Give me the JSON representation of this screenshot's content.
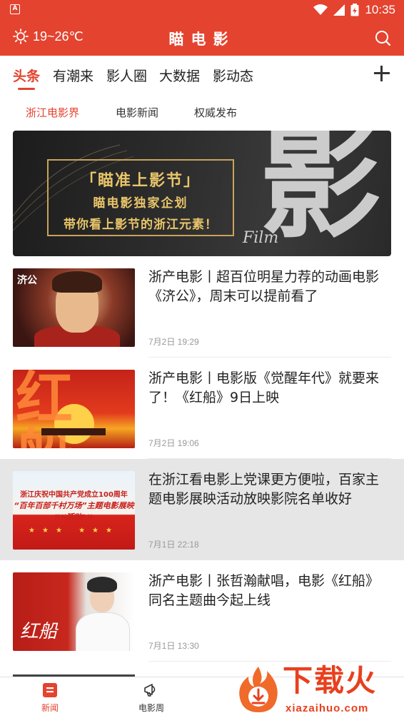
{
  "status_bar": {
    "time": "10:35",
    "left_icon": "a-notification-icon",
    "icons": [
      "wifi-icon",
      "signal-icon",
      "battery-icon"
    ]
  },
  "app_bar": {
    "weather": "19~26℃",
    "weather_icon": "sun-icon",
    "title": "瞄电影",
    "search_icon": "search-icon"
  },
  "tabs": [
    {
      "label": "头条",
      "active": true
    },
    {
      "label": "有潮来",
      "active": false
    },
    {
      "label": "影人圈",
      "active": false
    },
    {
      "label": "大数据",
      "active": false
    },
    {
      "label": "影动态",
      "active": false
    }
  ],
  "add_icon": "plus-icon",
  "sub_tabs": [
    {
      "label": "浙江电影界",
      "active": true
    },
    {
      "label": "电影新闻",
      "active": false
    },
    {
      "label": "权威发布",
      "active": false
    }
  ],
  "banner": {
    "line1": "「瞄准上影节」",
    "line2": "瞄电影独家企划",
    "line3": "带你看上影节的浙江元素！",
    "big_char": "影",
    "film_text": "Film"
  },
  "news": [
    {
      "title": "浙产电影丨超百位明星力荐的动画电影《济公》，周末可以提前看了",
      "time": "7月2日 19:29",
      "thumb_badge": "济公"
    },
    {
      "title": "浙产电影丨电影版《觉醒年代》就要来了！《红船》9日上映",
      "time": "7月2日 19:06",
      "thumb_text": "红船"
    },
    {
      "title": "在浙江看电影上党课更方便啦，百家主题电影展映活动放映影院名单收好",
      "time": "7月1日 22:18",
      "pressed": true,
      "thumb_l1": "浙江庆祝中国共产党成立100周年",
      "thumb_l2": "“百年百部千村万场”主题电影展映活动",
      "thumb_l3": "放映影院名单",
      "thumb_stars": "★★★  ★★★"
    },
    {
      "title": "浙产电影丨张哲瀚献唱，电影《红船》同名主题曲今起上线",
      "time": "7月1日 13:30",
      "thumb_text": "红船"
    }
  ],
  "bottom_nav": [
    {
      "label": "新闻",
      "icon": "news-icon",
      "active": true
    },
    {
      "label": "电影周",
      "icon": "megaphone-icon",
      "active": false
    }
  ],
  "watermark": {
    "text": "下载火",
    "url": "xiazaihuo.com"
  },
  "colors": {
    "brand_red": "#e4432f",
    "text": "#222222",
    "meta_gray": "#999999",
    "pressed_bg": "#e6e6e6"
  }
}
